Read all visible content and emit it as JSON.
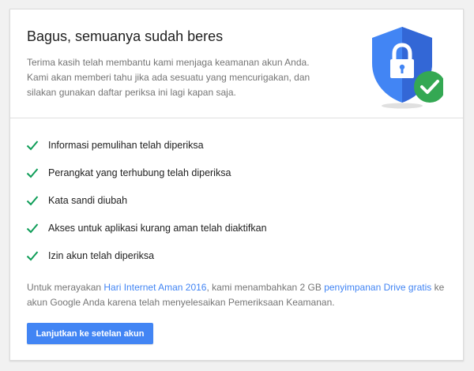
{
  "header": {
    "title": "Bagus, semuanya sudah beres",
    "intro": "Terima kasih telah membantu kami menjaga keamanan akun Anda. Kami akan memberi tahu jika ada sesuatu yang mencurigakan, dan silakan gunakan daftar periksa ini lagi kapan saja.",
    "illustration_icons": [
      "shield-icon",
      "lock-icon",
      "check-circle-icon"
    ]
  },
  "checklist": {
    "icon": "check-icon",
    "items": [
      "Informasi pemulihan telah diperiksa",
      "Perangkat yang terhubung telah diperiksa",
      "Kata sandi diubah",
      "Akses untuk aplikasi kurang aman telah diaktifkan",
      "Izin akun telah diperiksa"
    ]
  },
  "footer": {
    "text_1": "Untuk merayakan ",
    "link_1": "Hari Internet Aman 2016",
    "text_2": ", kami menambahkan 2 GB ",
    "link_2": "penyimpanan Drive gratis",
    "text_3": " ke akun Google Anda karena telah menyelesaikan Pemeriksaan Keamanan."
  },
  "actions": {
    "continue_label": "Lanjutkan ke setelan akun"
  },
  "colors": {
    "accent": "#4285f4",
    "shield": "#4285f4",
    "shield_dark": "#3367d6",
    "success": "#34a853",
    "check_mark": "#0f9d58"
  }
}
